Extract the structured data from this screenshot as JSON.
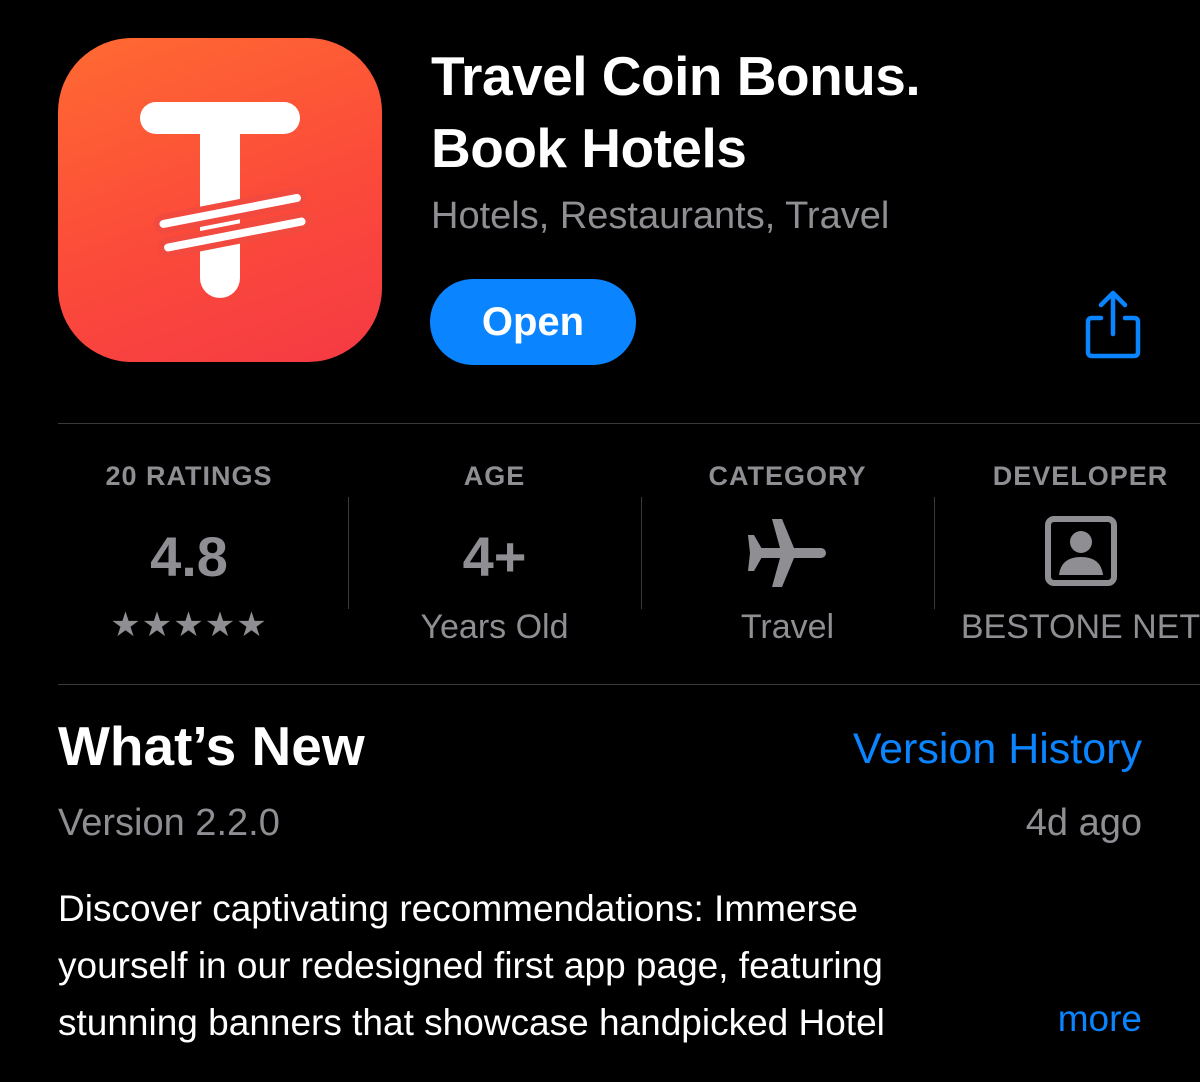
{
  "app": {
    "title_line1": "Travel Coin Bonus.",
    "title_line2": "Book Hotels",
    "subtitle": "Hotels, Restaurants, Travel",
    "icon": "travel-coin-logo",
    "icon_gradient": [
      "#ff6a32",
      "#f53a44"
    ]
  },
  "actions": {
    "open_label": "Open",
    "share_icon": "share-icon",
    "accent_color": "#0a84ff"
  },
  "info": {
    "ratings": {
      "label": "20 RATINGS",
      "value": "4.8",
      "stars": "★★★★★",
      "star_rating": 4.8
    },
    "age": {
      "label": "AGE",
      "value": "4+",
      "sub": "Years Old"
    },
    "category": {
      "label": "CATEGORY",
      "icon": "airplane-icon",
      "sub": "Travel"
    },
    "developer": {
      "label": "DEVELOPER",
      "icon": "person-icon",
      "sub": "BESTONE NET"
    }
  },
  "whats_new": {
    "title": "What’s New",
    "version_history_label": "Version History",
    "version": "Version 2.2.0",
    "age": "4d ago",
    "notes_lines": [
      "Discover captivating recommendations: Immerse",
      "yourself in our redesigned first app page, featuring",
      "stunning banners that showcase handpicked Hotel"
    ],
    "more_label": "more"
  }
}
